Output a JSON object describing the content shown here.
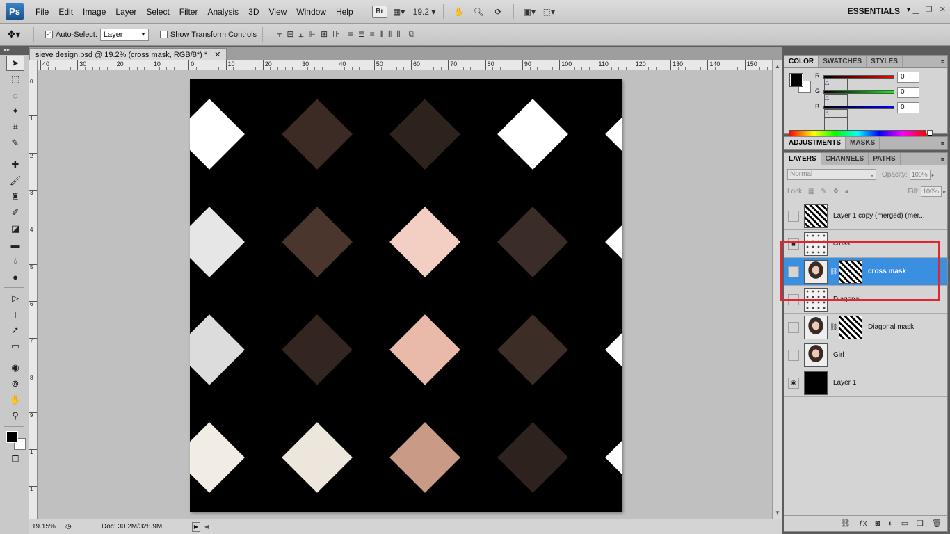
{
  "app": {
    "logo": "Ps",
    "workspace": "ESSENTIALS",
    "zoom_field": "19.2",
    "bridge_label": "Br"
  },
  "menu": [
    "File",
    "Edit",
    "Image",
    "Layer",
    "Select",
    "Filter",
    "Analysis",
    "3D",
    "View",
    "Window",
    "Help"
  ],
  "options": {
    "auto_select_label": "Auto-Select:",
    "auto_select_value": "Layer",
    "show_transform_label": "Show Transform Controls"
  },
  "document": {
    "tab_title": "sieve design.psd @ 19.2% (cross mask, RGB/8*) *",
    "close": "✕"
  },
  "ruler_top": [
    "40",
    "30",
    "20",
    "10",
    "0",
    "10",
    "20",
    "30",
    "40",
    "50",
    "60",
    "70",
    "80",
    "90",
    "100",
    "110",
    "120",
    "130",
    "140",
    "150"
  ],
  "ruler_left": [
    "0",
    "1",
    "2",
    "3",
    "4",
    "5",
    "6",
    "7",
    "8",
    "9",
    "1",
    "1"
  ],
  "status": {
    "zoom": "19.15%",
    "doc": "Doc: 30.2M/328.9M"
  },
  "color_panel": {
    "tabs": [
      "COLOR",
      "SWATCHES",
      "STYLES"
    ],
    "sliders": [
      {
        "label": "R",
        "value": "0",
        "gradient": "#ff0000"
      },
      {
        "label": "G",
        "value": "0",
        "gradient": "#00ff00"
      },
      {
        "label": "B",
        "value": "0",
        "gradient": "#0000ff"
      }
    ]
  },
  "adjustments_panel": {
    "tabs": [
      "ADJUSTMENTS",
      "MASKS"
    ]
  },
  "layers_panel": {
    "tabs": [
      "LAYERS",
      "CHANNELS",
      "PATHS"
    ],
    "blend_mode": "Normal",
    "opacity_label": "Opacity:",
    "opacity_value": "100%",
    "lock_label": "Lock:",
    "fill_label": "Fill:",
    "fill_value": "100%",
    "layers": [
      {
        "name": "Layer 1 copy (merged) (mer...",
        "visible": false,
        "thumb": "stripes",
        "mask": null,
        "selected": false
      },
      {
        "name": "cross",
        "visible": true,
        "thumb": "pattern",
        "mask": null,
        "selected": false
      },
      {
        "name": "cross mask",
        "visible": false,
        "thumb": "girl",
        "mask": "stripes",
        "selected": true
      },
      {
        "name": "Diagonal",
        "visible": false,
        "thumb": "pattern",
        "mask": null,
        "selected": false
      },
      {
        "name": "Diagonal mask",
        "visible": false,
        "thumb": "girl",
        "mask": "stripes",
        "selected": false
      },
      {
        "name": "Girl",
        "visible": false,
        "thumb": "girl",
        "mask": null,
        "selected": false
      },
      {
        "name": "Layer 1",
        "visible": true,
        "thumb": "black",
        "mask": null,
        "selected": false
      }
    ]
  },
  "canvas": {
    "diamonds": [
      {
        "row": 0,
        "col": 0,
        "fill": "#ffffff"
      },
      {
        "row": 0,
        "col": 1,
        "fill": "#3b2b24"
      },
      {
        "row": 0,
        "col": 2,
        "fill": "#2e221d"
      },
      {
        "row": 0,
        "col": 3,
        "fill": "#ffffff"
      },
      {
        "row": 0,
        "col": 4,
        "fill": "#ffffff"
      },
      {
        "row": 1,
        "col": 0,
        "fill": "#e6e6e6"
      },
      {
        "row": 1,
        "col": 1,
        "fill": "#4a362c"
      },
      {
        "row": 1,
        "col": 2,
        "fill": "#f2cfc2"
      },
      {
        "row": 1,
        "col": 3,
        "fill": "#3a2c26"
      },
      {
        "row": 1,
        "col": 4,
        "fill": "#ffffff"
      },
      {
        "row": 2,
        "col": 0,
        "fill": "#dcdcdc"
      },
      {
        "row": 2,
        "col": 1,
        "fill": "#33251f"
      },
      {
        "row": 2,
        "col": 2,
        "fill": "#e9b9aa"
      },
      {
        "row": 2,
        "col": 3,
        "fill": "#3c2d27"
      },
      {
        "row": 2,
        "col": 4,
        "fill": "#ffffff"
      },
      {
        "row": 3,
        "col": 0,
        "fill": "#f1ece4"
      },
      {
        "row": 3,
        "col": 1,
        "fill": "#ece6dc"
      },
      {
        "row": 3,
        "col": 2,
        "fill": "#c99a86"
      },
      {
        "row": 3,
        "col": 3,
        "fill": "#2d221e"
      },
      {
        "row": 3,
        "col": 4,
        "fill": "#ffffff"
      }
    ]
  }
}
